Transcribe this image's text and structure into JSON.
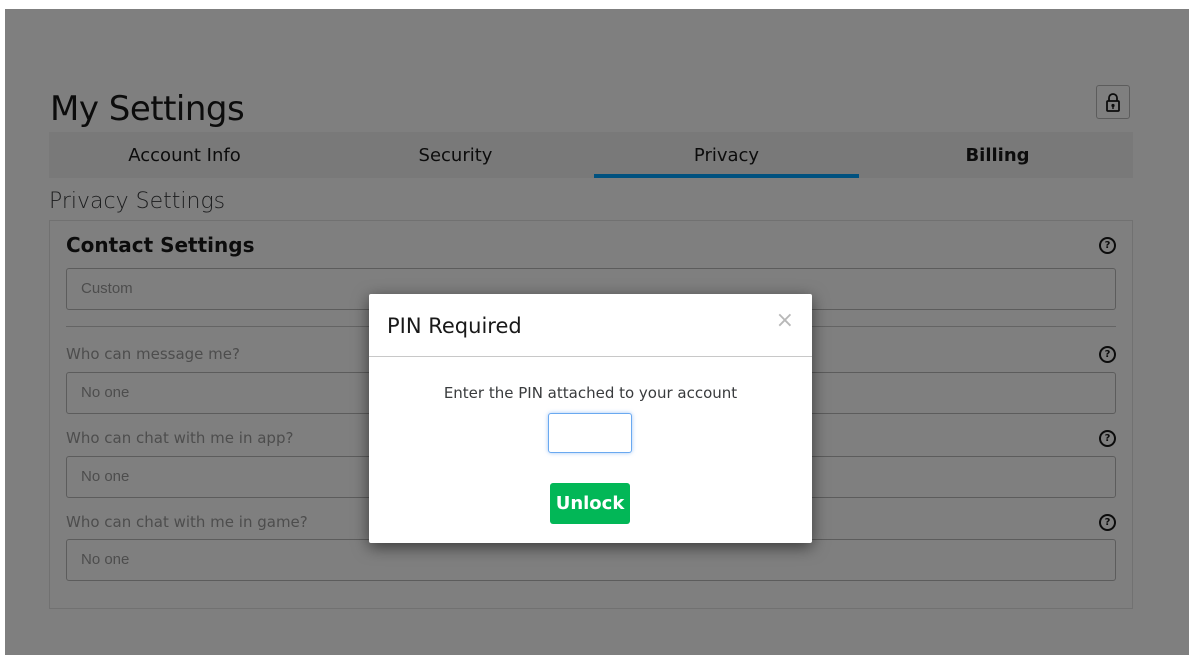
{
  "page_title": "My Settings",
  "tabs": [
    {
      "label": "Account Info",
      "active": false
    },
    {
      "label": "Security",
      "active": false
    },
    {
      "label": "Privacy",
      "active": true
    },
    {
      "label": "Billing",
      "active": false
    }
  ],
  "section_title": "Privacy Settings",
  "contact": {
    "heading": "Contact Settings",
    "value": "Custom",
    "fields": [
      {
        "label": "Who can message me?",
        "value": "No one"
      },
      {
        "label": "Who can chat with me in app?",
        "value": "No one"
      },
      {
        "label": "Who can chat with me in game?",
        "value": "No one"
      }
    ]
  },
  "modal": {
    "title": "PIN Required",
    "close_glyph": "×",
    "message": "Enter the PIN attached to your account",
    "pin_value": "",
    "button_label": "Unlock"
  },
  "icons": {
    "help": "?",
    "lock": "lock-icon"
  },
  "colors": {
    "active_tab": "#00a2ff",
    "unlock_button": "#02b757"
  }
}
